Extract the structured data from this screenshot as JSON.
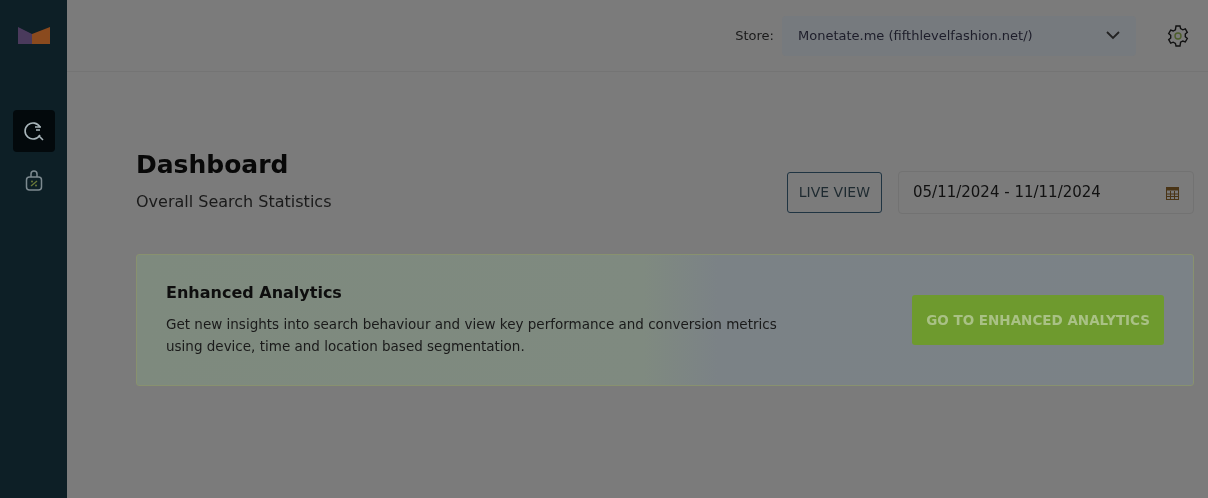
{
  "sidebar": {
    "items": [
      {
        "kind": "search",
        "selected": true
      },
      {
        "kind": "bag",
        "selected": false
      }
    ]
  },
  "header": {
    "store_label": "Store:",
    "store_value": "Monetate.me (fifthlevelfashion.net/)"
  },
  "page": {
    "title": "Dashboard",
    "subtitle": "Overall Search Statistics",
    "live_view_button": "LIVE VIEW",
    "date_range": "05/11/2024 - 11/11/2024"
  },
  "banner": {
    "title": "Enhanced Analytics",
    "text": "Get new insights into search behaviour and view key performance and conversion metrics using device, time and location based segmentation.",
    "button": "GO TO ENHANCED ANALYTICS"
  }
}
